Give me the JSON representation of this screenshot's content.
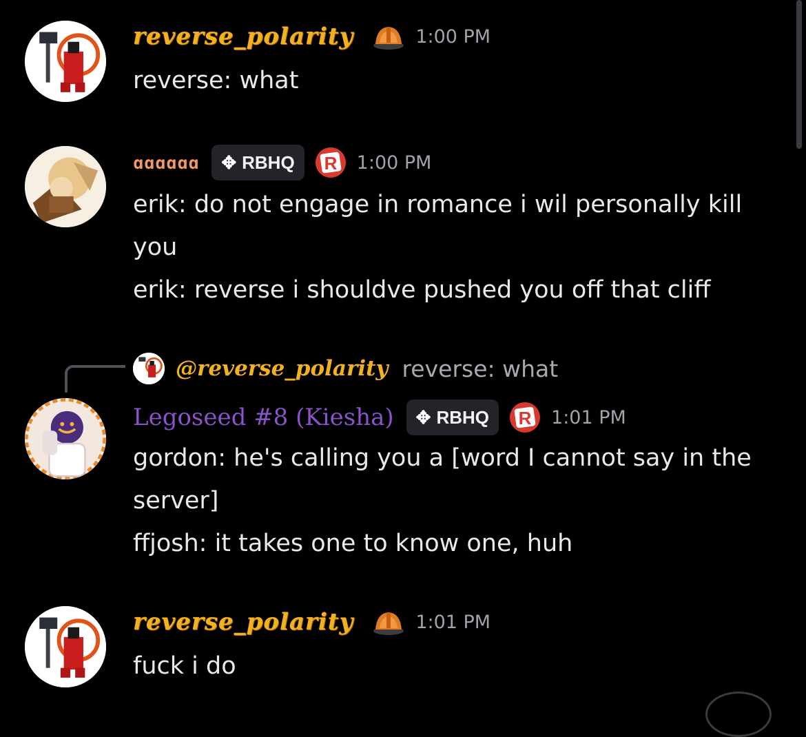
{
  "messages": [
    {
      "username": "reverse_polarity",
      "time": "1:00 PM",
      "lines": [
        "reverse: what"
      ]
    },
    {
      "username": "ɑɑɑɑɑɑ",
      "tag": "RBHQ",
      "time": "1:00 PM",
      "lines": [
        "erik: do not engage in romance i wil personally kill you",
        "erik: reverse i shouldve pushed you off that cliff"
      ]
    },
    {
      "reply": {
        "mention": "@reverse_polarity",
        "text": "reverse: what"
      },
      "username": "Legoseed #8 (Kiesha)",
      "tag": "RBHQ",
      "time": "1:01 PM",
      "lines": [
        "gordon: he's calling you a [word I cannot say in the server]",
        "ffjosh: it takes one to know one, huh"
      ]
    },
    {
      "username": "reverse_polarity",
      "time": "1:01 PM",
      "lines": [
        "fuck i do"
      ]
    }
  ],
  "colors": {
    "background": "#000000",
    "username_gold": "#f2b21f",
    "username_orange": "#f29a5c",
    "username_purple": "#8a53c9",
    "timestamp": "#a1a3aa"
  },
  "icons": [
    "hard-hat-badge-icon",
    "rbhq-diamond-icon",
    "roblox-logo-icon"
  ]
}
